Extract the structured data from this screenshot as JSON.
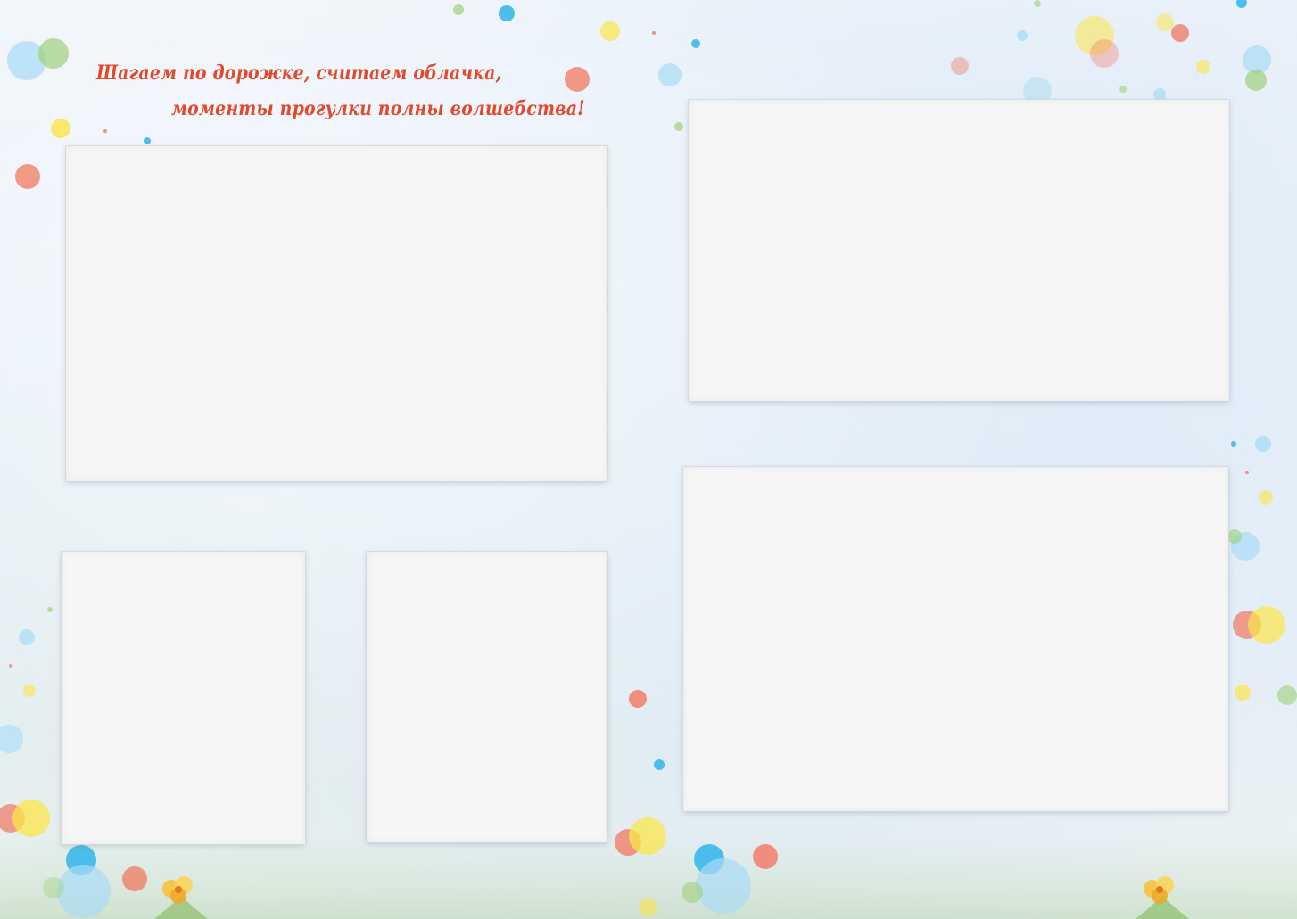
{
  "headline": {
    "line1": "Шагаем по дорожке, считаем облачка,",
    "line2": "моменты прогулки полны волшебства!"
  },
  "colors": {
    "headline": "#e04a2d",
    "frame": "#f6f6f6",
    "background": "#eaf1f9",
    "dot_blue": "#3ab8ea",
    "dot_light_blue": "#a9dcf5",
    "dot_red": "#f0785f",
    "dot_yellow": "#fbe54a",
    "dot_green": "#9fd07a"
  },
  "photo_frames": [
    {
      "id": "large-top-left"
    },
    {
      "id": "large-top-right"
    },
    {
      "id": "small-bottom-left"
    },
    {
      "id": "small-bottom-middle"
    },
    {
      "id": "large-bottom-right"
    }
  ],
  "decorations": {
    "confetti_dots": "colorful-circles",
    "flowers": "yellow-flower-icons"
  }
}
